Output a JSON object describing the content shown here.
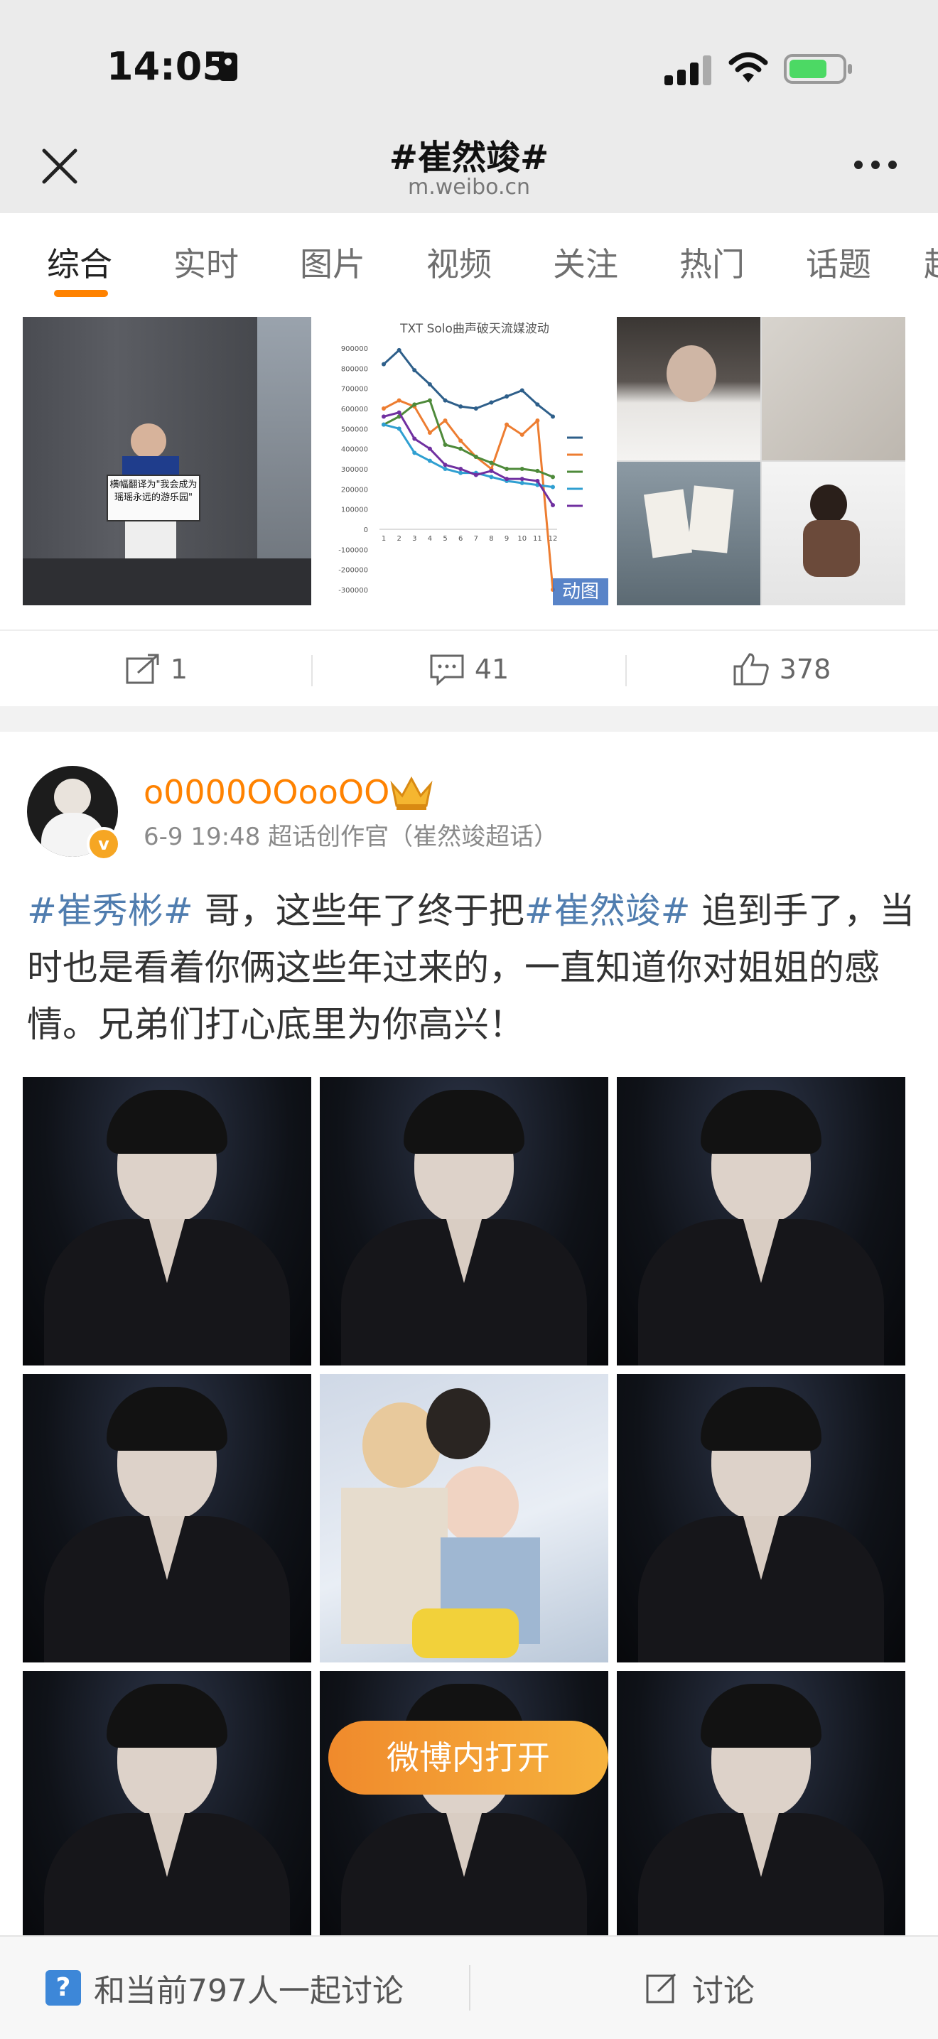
{
  "status_bar": {
    "time": "14:05"
  },
  "header": {
    "title": "#崔然竣#",
    "subtitle": "m.weibo.cn"
  },
  "tabs": [
    {
      "label": "综合"
    },
    {
      "label": "实时"
    },
    {
      "label": "图片"
    },
    {
      "label": "视频"
    },
    {
      "label": "关注"
    },
    {
      "label": "热门"
    },
    {
      "label": "话题"
    },
    {
      "label": "超"
    }
  ],
  "post1": {
    "chart": {
      "title": "TXT Solo曲声破天流媒波动",
      "gif_badge": "动图",
      "poster_text": "横幅翻译为\"我会成为\n瑶瑶永远的游乐园\""
    },
    "actions": {
      "repost": "1",
      "comments": "41",
      "likes": "378"
    }
  },
  "post2": {
    "username": "o0000OOooOO",
    "meta": "6-9 19:48  超话创作官（崔然竣超话）",
    "text": {
      "tag1": "#崔秀彬#",
      "mid": " 哥，这些年了终于把",
      "tag2": "#崔然竣#",
      "rest": " 追到手了，当时也是看着你俩这些年过来的，一直知道你对姐姐的感情。兄弟们打心底里为你高兴！"
    },
    "open_in_app": "微博内打开"
  },
  "bottom_bar": {
    "discuss_prompt": "和当前797人一起讨论",
    "discuss": "讨论"
  },
  "chart_data": {
    "type": "line",
    "title": "TXT Solo曲声破天流媒波动",
    "x": [
      1,
      2,
      3,
      4,
      5,
      6,
      7,
      8,
      9,
      10,
      11,
      12
    ],
    "ylim": [
      -300000,
      900000
    ],
    "yticks": [
      "900000",
      "800000",
      "700000",
      "600000",
      "500000",
      "400000",
      "300000",
      "200000",
      "100000",
      "0",
      "-100000",
      "-200000",
      "-300000"
    ],
    "series": [
      {
        "color": "#2e5f8a",
        "values": [
          820000,
          890000,
          790000,
          720000,
          640000,
          610000,
          600000,
          630000,
          660000,
          690000,
          620000,
          560000
        ]
      },
      {
        "color": "#ed7d31",
        "values": [
          600000,
          640000,
          610000,
          480000,
          540000,
          440000,
          360000,
          300000,
          520000,
          470000,
          540000,
          -300000
        ]
      },
      {
        "color": "#4e8a3a",
        "values": [
          520000,
          560000,
          620000,
          640000,
          420000,
          400000,
          360000,
          330000,
          300000,
          300000,
          290000,
          260000
        ]
      },
      {
        "color": "#2f9fd1",
        "values": [
          520000,
          500000,
          380000,
          340000,
          300000,
          280000,
          280000,
          260000,
          240000,
          230000,
          220000,
          210000
        ]
      },
      {
        "color": "#7030a0",
        "values": [
          560000,
          580000,
          450000,
          400000,
          320000,
          300000,
          270000,
          290000,
          250000,
          250000,
          240000,
          120000
        ]
      }
    ]
  }
}
